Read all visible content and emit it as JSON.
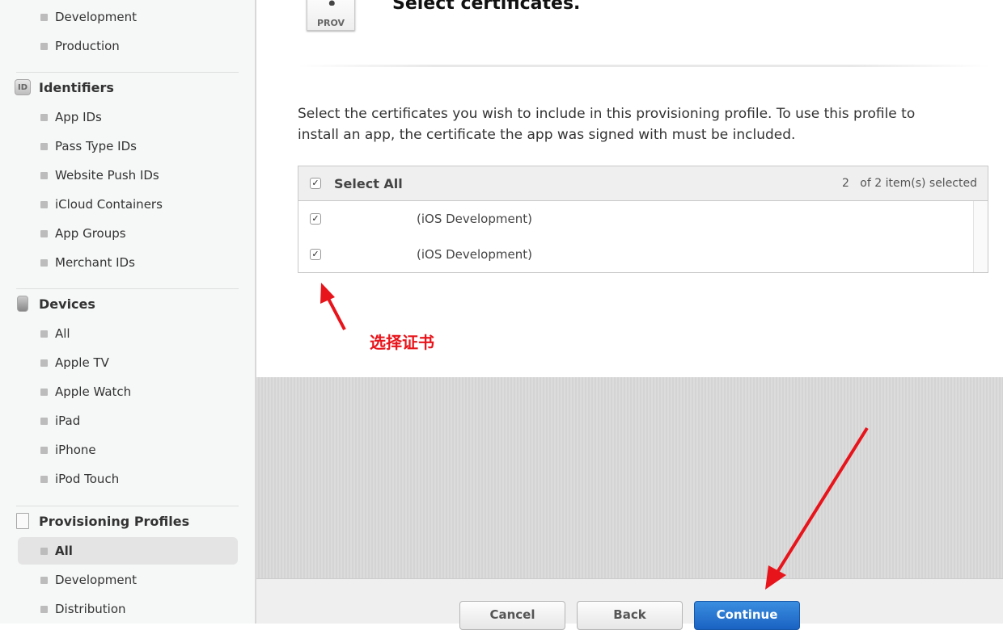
{
  "sidebar": {
    "top_items": [
      "Development",
      "Production"
    ],
    "identifiers": {
      "icon": "id-badge-icon",
      "badge": "ID",
      "title": "Identifiers",
      "items": [
        "App IDs",
        "Pass Type IDs",
        "Website Push IDs",
        "iCloud Containers",
        "App Groups",
        "Merchant IDs"
      ]
    },
    "devices": {
      "icon": "device-icon",
      "title": "Devices",
      "items": [
        "All",
        "Apple TV",
        "Apple Watch",
        "iPad",
        "iPhone",
        "iPod Touch"
      ]
    },
    "profiles": {
      "icon": "document-icon",
      "title": "Provisioning Profiles",
      "items": [
        "All",
        "Development",
        "Distribution"
      ],
      "selected": "All"
    }
  },
  "main": {
    "icon_label": "PROV",
    "title": "Select certificates.",
    "description": "Select the certificates you wish to include in this provisioning profile. To use this profile to install an app, the certificate the app was signed with must be included.",
    "table": {
      "select_all": "Select All",
      "select_all_checked": true,
      "selected_count": "2",
      "count_suffix": "of 2 item(s) selected",
      "rows": [
        {
          "name": "(iOS Development)",
          "checked": true
        },
        {
          "name": "(iOS Development)",
          "checked": true
        }
      ]
    },
    "annotation": "选择证书",
    "annotation_color": "#e8141b"
  },
  "footer": {
    "cancel": "Cancel",
    "back": "Back",
    "continue": "Continue",
    "accent": "#1a62c2"
  }
}
